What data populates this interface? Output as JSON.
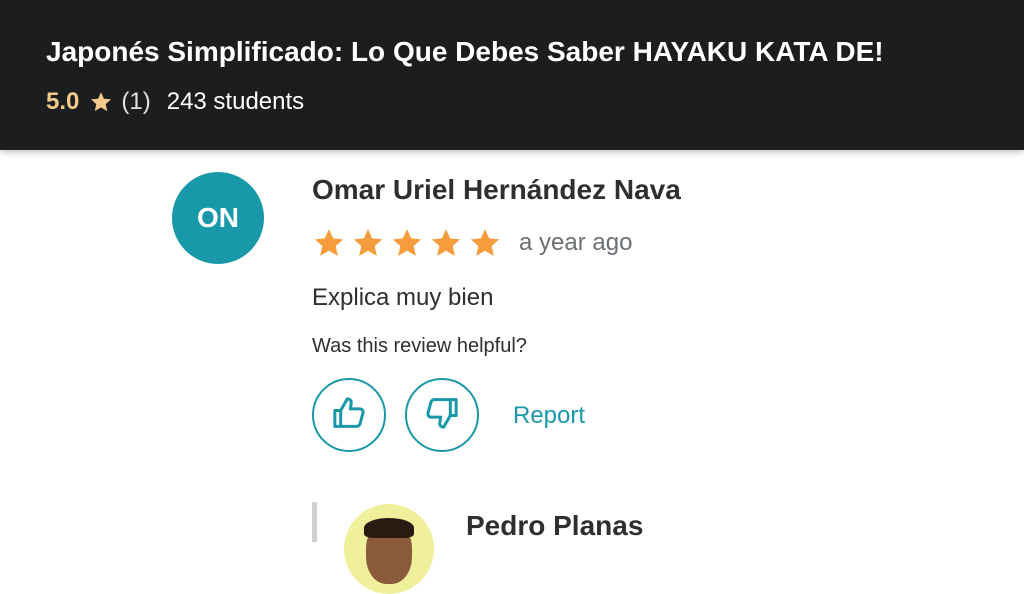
{
  "course": {
    "title": "Japonés Simplificado: Lo Que Debes Saber HAYAKU KATA DE!",
    "rating": "5.0",
    "rating_count": "(1)",
    "students": "243 students"
  },
  "review": {
    "avatar_initials": "ON",
    "reviewer_name": "Omar Uriel Hernández Nava",
    "stars": 5,
    "date": "a year ago",
    "text": "Explica muy bien",
    "helpful_prompt": "Was this review helpful?",
    "report_label": "Report"
  },
  "response": {
    "responder_name": "Pedro Planas"
  },
  "colors": {
    "header_bg": "#1c1d1f",
    "rating_gold": "#f3ca8c",
    "star_orange": "#f69c3d",
    "accent_teal": "#1998a9",
    "text_dark": "#2d2f31",
    "text_muted": "#6a6f73"
  },
  "icons": {
    "rating": "star-icon",
    "helpful_yes": "thumbs-up-icon",
    "helpful_no": "thumbs-down-icon"
  }
}
